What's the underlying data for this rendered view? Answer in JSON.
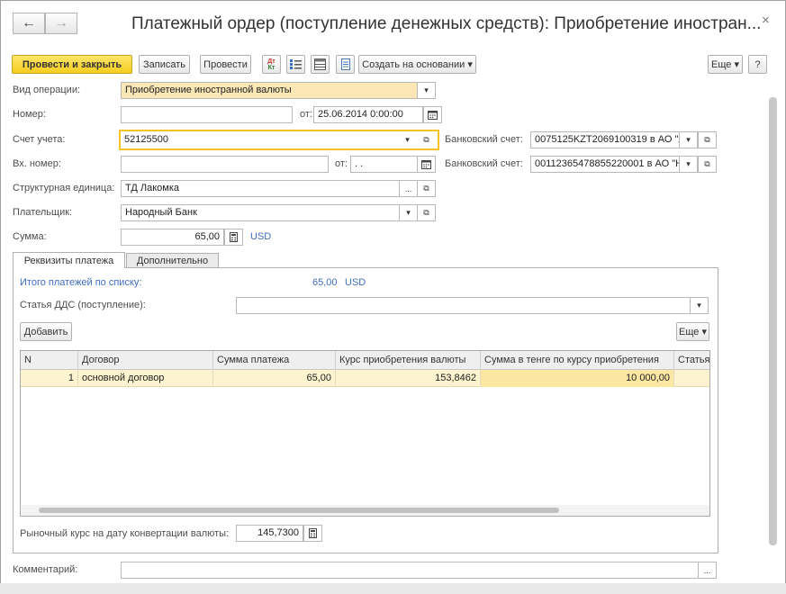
{
  "nav": {
    "back_icon": "←",
    "forward_icon": "→"
  },
  "window": {
    "title": "Платежный ордер (поступление денежных средств): Приобретение иностран...",
    "close_icon": "×"
  },
  "toolbar": {
    "post_close": "Провести и закрыть",
    "save": "Записать",
    "post": "Провести",
    "dtkt_top": "Дт",
    "dtkt_bottom": "Кт",
    "create_based": "Создать на основании ▾",
    "more": "Еще ▾",
    "help": "?"
  },
  "form": {
    "operation_type": {
      "label": "Вид операции:",
      "value": "Приобретение иностранной валюты"
    },
    "number": {
      "label": "Номер:",
      "value": ""
    },
    "date": {
      "label": "от:",
      "value": "25.06.2014  0:00:00"
    },
    "account": {
      "label": "Счет учета:",
      "value": "52125500"
    },
    "bank_account_1": {
      "label": "Банковский счет:",
      "value": "0075125KZT2069100319 в АО \"А"
    },
    "incoming_number": {
      "label": "Вх. номер:",
      "value": ""
    },
    "incoming_date": {
      "label": "от:",
      "value": " .  .    "
    },
    "bank_account_2": {
      "label": "Банковский счет:",
      "value": "00112365478855220001 в АО \"Н"
    },
    "division": {
      "label": "Структурная единица:",
      "value": "ТД Лакомка"
    },
    "payer": {
      "label": "Плательщик:",
      "value": "Народный Банк"
    },
    "amount": {
      "label": "Сумма:",
      "value": "65,00",
      "currency": "USD"
    },
    "comment": {
      "label": "Комментарий:",
      "value": ""
    }
  },
  "tabs": [
    {
      "label": "Реквизиты платежа",
      "active": true
    },
    {
      "label": "Дополнительно",
      "active": false
    }
  ],
  "payment": {
    "total_label": "Итого платежей по списку:",
    "total_value": "65,00",
    "total_currency": "USD",
    "cashflow_label": "Статья ДДС (поступление):",
    "cashflow_value": "",
    "add_button": "Добавить",
    "more_button": "Еще ▾",
    "columns": [
      "N",
      "Договор",
      "Сумма платежа",
      "Курс приобретения валюты",
      "Сумма в тенге по курсу приобретения",
      "Статья"
    ],
    "rows": [
      {
        "n": "1",
        "contract": "основной договор",
        "amount": "65,00",
        "rate": "153,8462",
        "amount_kzt": "10 000,00",
        "article": ""
      }
    ],
    "market_rate_label": "Рыночный курс на дату конвертации валюты:",
    "market_rate_value": "145,7300"
  }
}
